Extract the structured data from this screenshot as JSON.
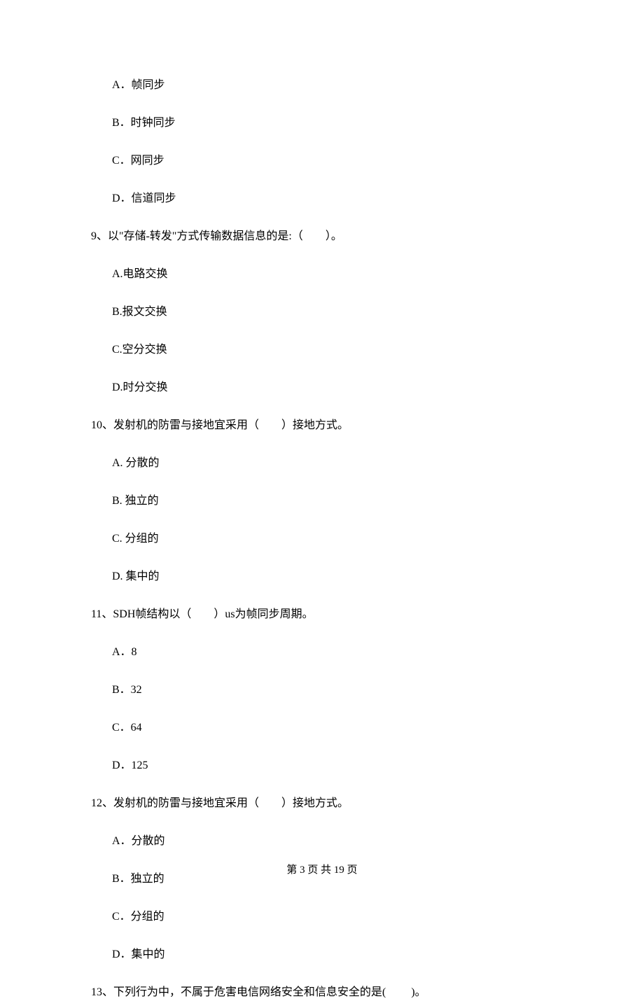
{
  "q8_options": {
    "a": "A．帧同步",
    "b": "B．时钟同步",
    "c": "C．网同步",
    "d": "D．信道同步"
  },
  "q9": {
    "text": "9、以\"存储-转发\"方式传输数据信息的是:（　　）。",
    "a": "A.电路交换",
    "b": "B.报文交换",
    "c": "C.空分交换",
    "d": "D.时分交换"
  },
  "q10": {
    "text": "10、发射机的防雷与接地宜采用（　　）接地方式。",
    "a": "A. 分散的",
    "b": "B. 独立的",
    "c": "C. 分组的",
    "d": "D. 集中的"
  },
  "q11": {
    "text": "11、SDH帧结构以（　　）us为帧同步周期。",
    "a": "A．8",
    "b": "B．32",
    "c": "C．64",
    "d": "D．125"
  },
  "q12": {
    "text": "12、发射机的防雷与接地宜采用（　　）接地方式。",
    "a": "A．分散的",
    "b": "B．独立的",
    "c": "C．分组的",
    "d": "D．集中的"
  },
  "q13": {
    "text": "13、下列行为中，不属于危害电信网络安全和信息安全的是(　　 )。"
  },
  "footer": "第 3 页 共 19 页"
}
